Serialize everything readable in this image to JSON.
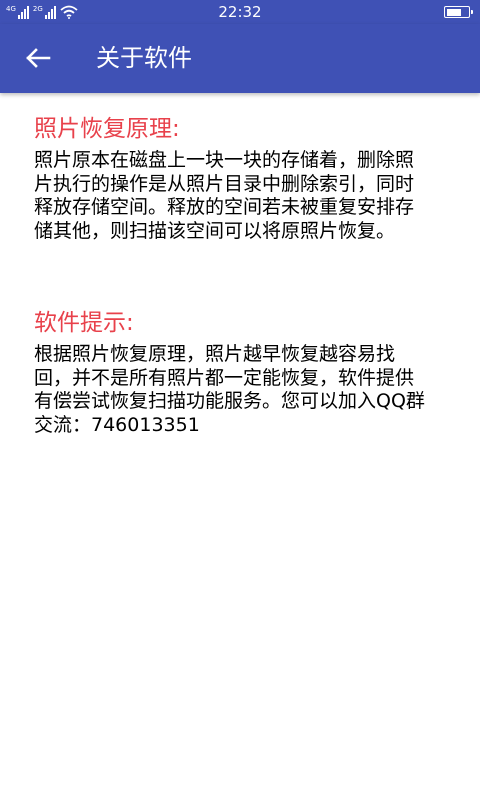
{
  "status_bar": {
    "sim1_label": "4G",
    "sim2_label": "2G",
    "time": "22:32",
    "battery_level": 0.72,
    "icons": [
      "signal-icon",
      "wifi-icon",
      "battery-icon"
    ]
  },
  "app_bar": {
    "title": "关于软件",
    "back_icon": "arrow-left-icon"
  },
  "sections": [
    {
      "title": "照片恢复原理:",
      "body": "照片原本在磁盘上一块一块的存储着，删除照\n片执行的操作是从照片目录中删除索引，同时\n释放存储空间。释放的空间若未被重复安排存\n储其他，则扫描该空间可以将原照片恢复。"
    },
    {
      "title": "软件提示:",
      "body": "根据照片恢复原理，照片越早恢复越容易找\n回，并不是所有照片都一定能恢复，软件提供\n有偿尝试恢复扫描功能服务。您可以加入QQ群\n交流：746013351"
    }
  ],
  "colors": {
    "app_bar": "#3f51b5",
    "section_title": "#e8414b",
    "body_text": "#000000"
  }
}
